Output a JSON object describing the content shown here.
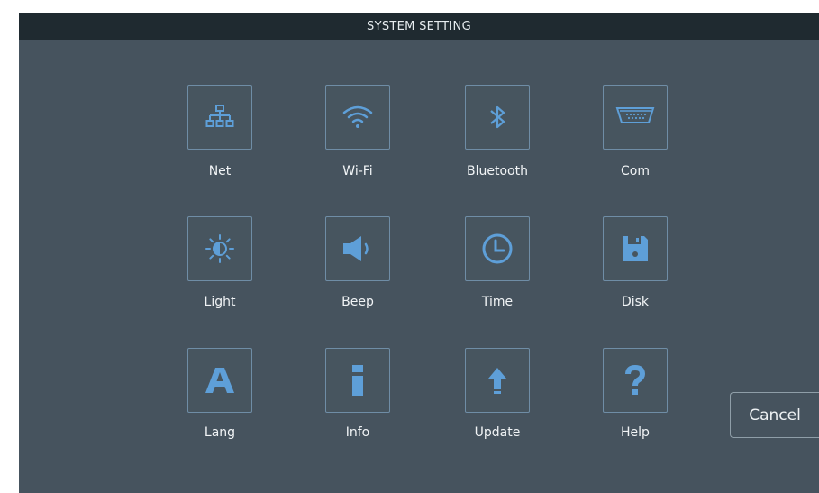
{
  "window": {
    "title": "SYSTEM SETTING"
  },
  "colors": {
    "icon": "#5e9fd8",
    "tile_border": "#6f8da6",
    "background": "#46535e",
    "titlebar": "#1f2a30"
  },
  "settings": [
    {
      "label": "Net",
      "icon": "network-icon"
    },
    {
      "label": "Wi-Fi",
      "icon": "wifi-icon"
    },
    {
      "label": "Bluetooth",
      "icon": "bluetooth-icon"
    },
    {
      "label": "Com",
      "icon": "serial-port-icon"
    },
    {
      "label": "Light",
      "icon": "brightness-icon"
    },
    {
      "label": "Beep",
      "icon": "speaker-icon"
    },
    {
      "label": "Time",
      "icon": "clock-icon"
    },
    {
      "label": "Disk",
      "icon": "floppy-disk-icon"
    },
    {
      "label": "Lang",
      "icon": "letter-a-icon"
    },
    {
      "label": "Info",
      "icon": "info-icon"
    },
    {
      "label": "Update",
      "icon": "upload-arrow-icon"
    },
    {
      "label": "Help",
      "icon": "question-mark-icon"
    }
  ],
  "actions": {
    "cancel_label": "Cancel"
  }
}
